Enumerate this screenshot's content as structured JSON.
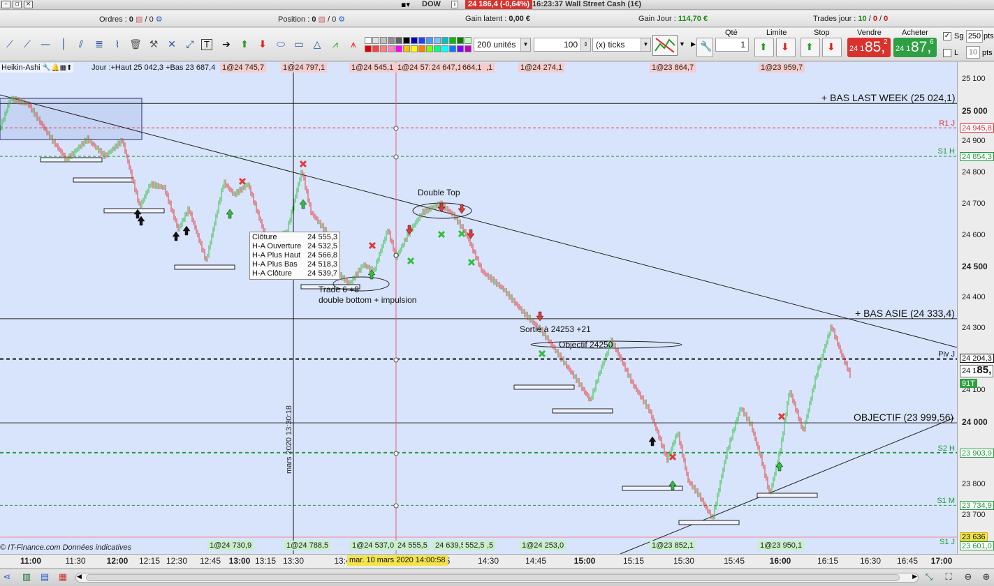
{
  "window": {
    "symbol": "DOW",
    "price_badge": "24 186,4 (-0,64%)",
    "time_title": "16:23:37  Wall Street Cash (1€)"
  },
  "info": {
    "orders_label": "Ordres :",
    "orders_value": "0",
    "orders_sep": "/ 0",
    "position_label": "Position :",
    "position_value": "0",
    "position_sep": "/ 0",
    "gain_latent_label": "Gain latent :",
    "gain_latent_value": "0,00 €",
    "gain_jour_label": "Gain Jour :",
    "gain_jour_value": "114,70 €",
    "trades_label": "Trades jour :",
    "trades_value_1": "10",
    "trades_value_2": "0",
    "trades_value_3": "0"
  },
  "toolbar": {
    "units_select": "200 unités",
    "qty_input": "100",
    "ticks_select": "(x) ticks",
    "labels": {
      "qty": "Qté",
      "limit": "Limite",
      "stop": "Stop",
      "sell": "Vendre",
      "buy": "Acheter"
    },
    "qty_value": "1",
    "sell": {
      "small": "24 1",
      "big": "85,",
      "sup": "2"
    },
    "buy": {
      "small": "24 1",
      "big": "87,",
      "sup": "6"
    },
    "sg_label": "Sg",
    "sg_value": "250",
    "sg_unit": "pts",
    "l_label": "L",
    "l_value": "10",
    "l_unit": "pts",
    "palette": [
      "#ffffff",
      "#e0e0e0",
      "#c0c0c0",
      "#909090",
      "#606060",
      "#000000",
      "#0000c0",
      "#2040ff",
      "#40a0ff",
      "#80c0ff",
      "#00c0c0",
      "#00c000",
      "#008000",
      "#c0ffc0",
      "#e00000",
      "#ff4040",
      "#ff8080",
      "#ff80c0",
      "#ff00ff",
      "#ffc000",
      "#ffff00",
      "#ff8000",
      "#80ff00",
      "#00ff80",
      "#00ffff",
      "#0080ff",
      "#8000ff",
      "#c000c0"
    ]
  },
  "chart": {
    "instrument_label": "Heikin-Ashi",
    "daily_label": "Jour :+Haut 25 042,3 +Bas 23 687,4",
    "top_markers": [
      "1@24 745,7",
      "1@24 797,1",
      "1@24 545,1",
      "1@24 572,6",
      "24 647,1",
      "664,1",
      ",1",
      "1@24 274,1",
      "1@23 864,7",
      "1@23 959,7"
    ],
    "bottom_markers": [
      "1@24 730,9",
      "1@24 788,5",
      "1@24 537,0",
      "24 555,5",
      "24 639,5",
      "552,5",
      ",5",
      "1@24 253,0",
      "1@23 852,1",
      "1@23 950,1"
    ],
    "h_labels": {
      "bas_last_week": "+ BAS LAST WEEK (25 024,1)",
      "bas_asie": "+ BAS ASIE (24 333,4)",
      "objectif": "OBJECTIF (23 999,56)"
    },
    "pivot_labels": {
      "r1j": "R1 J",
      "s1h": "S1 H",
      "pivj": "Piv J",
      "s2h": "S2 H",
      "s1m": "S1 M",
      "s1j": "S1 J"
    },
    "annotations": {
      "double_top": "Double Top",
      "trade": "Trade 6 +8",
      "double_bottom": "double bottom + impulsion",
      "sortie": "Sortie à 24253 +21",
      "objectif": "Objectif 24250"
    },
    "tooltip": [
      {
        "label": "Clôture",
        "value": "24 555,3"
      },
      {
        "label": "H-A Ouverture",
        "value": "24 532,5"
      },
      {
        "label": "H-A Plus Haut",
        "value": "24 566,8"
      },
      {
        "label": "H-A Plus Bas",
        "value": "24 518,3"
      },
      {
        "label": "H-A Clôture",
        "value": "24 539,7"
      }
    ],
    "copyright": "© IT-Finance.com  Données indicatives",
    "cursor_time": "mars 2020 13:30:18",
    "cursor_date": "mar. 10 mars 2020 14:00:58"
  },
  "price_axis": {
    "ticks": [
      "25 100",
      "25 000",
      "24 900",
      "24 800",
      "24 700",
      "24 600",
      "24 500",
      "24 400",
      "24 300",
      "24 200",
      "24 100",
      "24 000",
      "23 900",
      "23 800",
      "23 700"
    ],
    "badges": {
      "r1j": "24 945,8",
      "s1h": "24 854,3",
      "pivj": "24 204,3",
      "last": "24 1",
      "last_big": "85,",
      "tick_count": "91T",
      "s2h": "23 903,9",
      "s1m": "23 734,9",
      "s1j_yellow": "23 636",
      "s1j": "23 601,0"
    }
  },
  "time_axis": {
    "ticks": [
      "11:00",
      "11:30",
      "12:00",
      "12:15",
      "12:30",
      "12:45",
      "13:00",
      "13:15",
      "13:30",
      "13:4",
      "5",
      "14:30",
      "14:45",
      "15:00",
      "15:15",
      "15:30",
      "15:45",
      "16:00",
      "16:15",
      "16:30",
      "16:45",
      "17:00"
    ]
  },
  "colors": {
    "chart_bg": "#d8e4fb",
    "bull": "#2fbf3b",
    "bear": "#e23a3a",
    "sell_bg": "#d9322e",
    "buy_bg": "#2ea043",
    "pivot_red": "#e0303a",
    "pivot_green": "#1f9a3c"
  }
}
